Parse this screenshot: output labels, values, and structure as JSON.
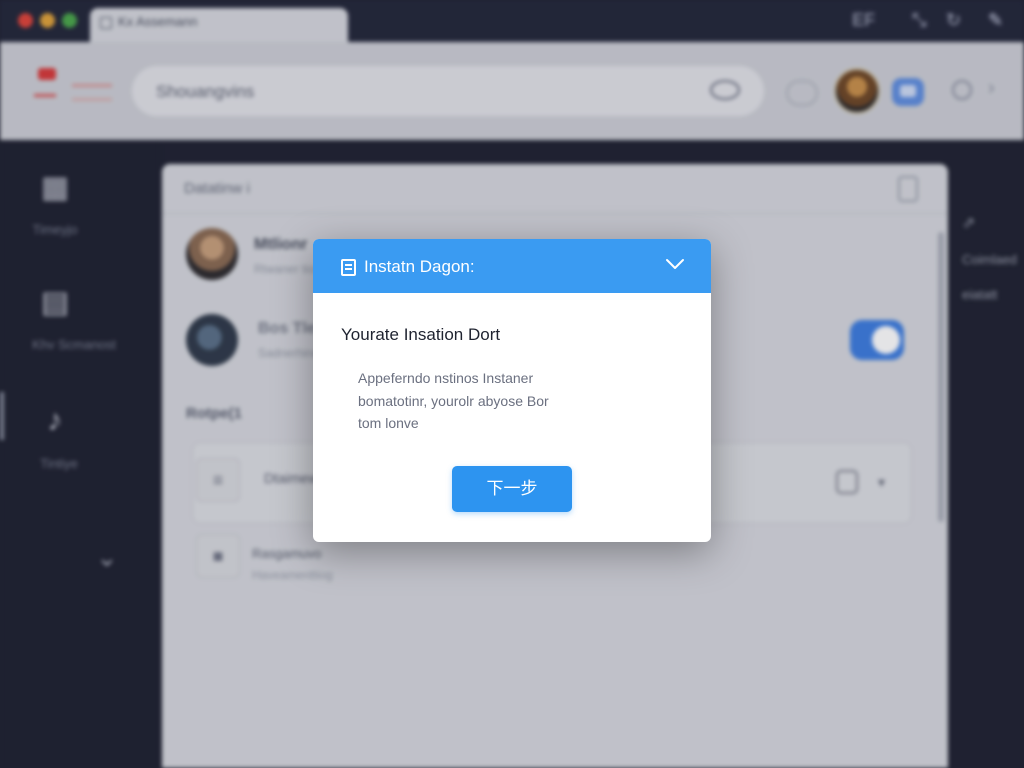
{
  "window": {
    "tab_title": "Kx Assemann",
    "top_right_label": "EF"
  },
  "toolbar": {
    "search_text": "Shouangvins"
  },
  "sidebar": {
    "items": [
      {
        "icon": "grid-icon",
        "label": "Timeyjo"
      },
      {
        "icon": "calendar-icon",
        "label": "Khv Scmanost"
      },
      {
        "icon": "music-note-icon",
        "label": "Tintiye"
      }
    ]
  },
  "right_rail": {
    "items": [
      "Coimlaed",
      "eiatatt"
    ]
  },
  "panel": {
    "title": "Datatinw i",
    "rows": [
      {
        "title": "Mtlionr",
        "subtitle": "Rtwaner tiona"
      },
      {
        "title": "Bos Tle",
        "subtitle": "Sadnerhinesin"
      }
    ],
    "section_label": "Rotpe(1",
    "list": [
      {
        "text": "Dtaimewr",
        "subtitle": ""
      },
      {
        "text": "Rasgamuvo",
        "subtitle": "Haveamenttiog"
      }
    ]
  },
  "dialog": {
    "title": "Instatn Dagon:",
    "heading": "Yourate Insation Dort",
    "body_lines": [
      "Appeferndo nstinos Instaner",
      "bomatotinr, yourolr abyose Bor",
      "tom lonve"
    ],
    "next_button_label": "下一步"
  },
  "colors": {
    "accent": "#3a9bf2",
    "button": "#2d94f0",
    "sidebar_bg": "#1e2130",
    "panel_bg": "#d6d8de"
  }
}
